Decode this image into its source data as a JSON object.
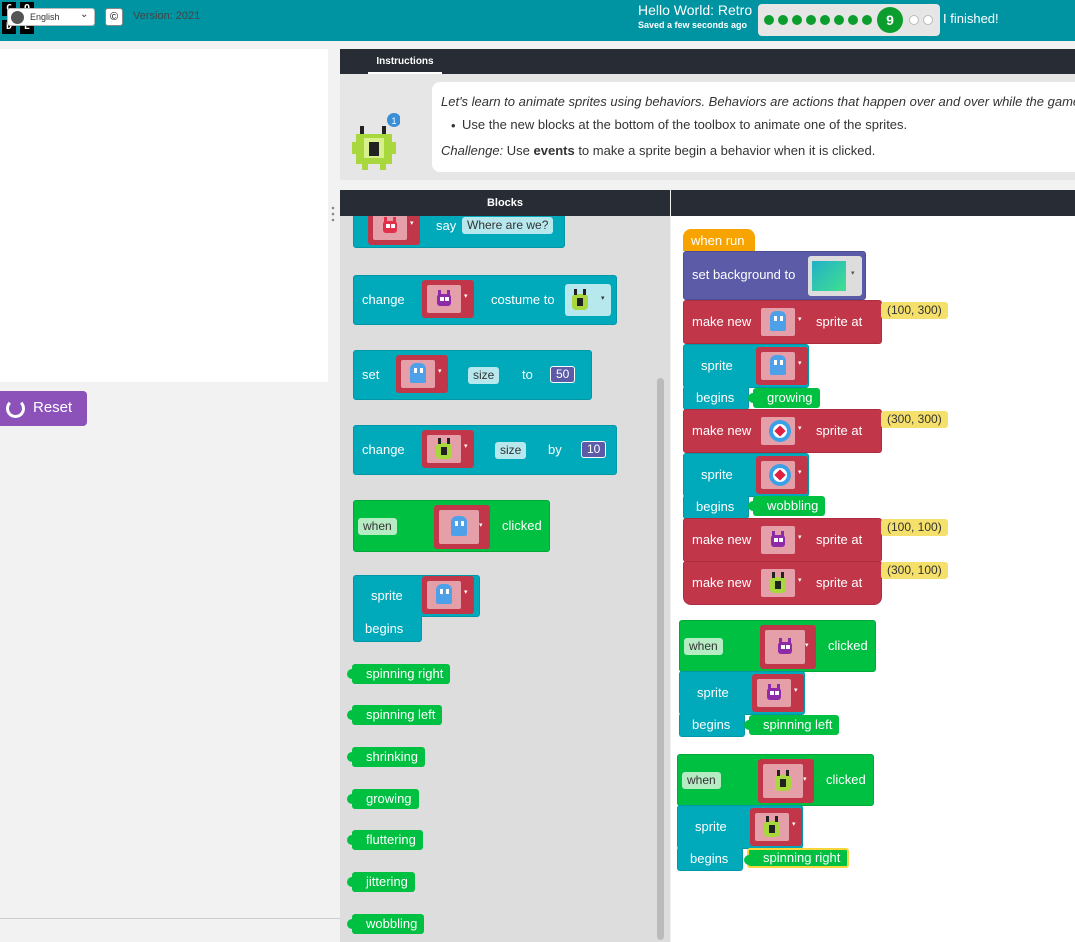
{
  "header": {
    "logo_letters": [
      "C",
      "O",
      "D",
      "E"
    ],
    "project_title": "Hello World: Retro",
    "saved_status": "Saved a few seconds ago",
    "progress": {
      "completed_levels": 8,
      "current_level": "9",
      "remaining_levels": 2
    },
    "finish_label": "I finished!",
    "colors": {
      "header_bg": "#0094a3",
      "done": "#0b9e2e"
    }
  },
  "stage": {
    "reset_label": "Reset",
    "reset_icon": "refresh-icon"
  },
  "footer": {
    "language": "English",
    "copyright_symbol": "©",
    "version": "Version: 2021"
  },
  "instructions": {
    "tab_label": "Instructions",
    "line1": "Let's learn to animate sprites using behaviors. Behaviors are actions that happen over and over while the game is running.",
    "bullet": "Use the new blocks at the bottom of the toolbox to animate one of the sprites.",
    "challenge_prefix": "Challenge:",
    "challenge_mid1": " Use ",
    "challenge_bold": "events",
    "challenge_rest": " to make a sprite begin a behavior when it is clicked.",
    "mascot_badge": "1"
  },
  "toolbox": {
    "header": "Blocks",
    "say_block": {
      "label": "say",
      "value": "Where are we?"
    },
    "change_costume": {
      "label": "change",
      "label2": "costume to"
    },
    "set_size": {
      "label": "set",
      "prop": "size",
      "to": "to",
      "value": "50"
    },
    "change_size": {
      "label": "change",
      "prop": "size",
      "by": "by",
      "value": "10"
    },
    "when_clicked": {
      "when": "when",
      "clicked": "clicked"
    },
    "sprite_begins": {
      "sprite": "sprite",
      "begins": "begins"
    },
    "behaviors": [
      "spinning right",
      "spinning left",
      "shrinking",
      "growing",
      "fluttering",
      "jittering",
      "wobbling"
    ]
  },
  "workspace": {
    "when_run": "when run",
    "set_background": "set background to",
    "make_new": "make new",
    "sprite_at": "sprite at",
    "sprite": "sprite",
    "begins": "begins",
    "when": "when",
    "clicked": "clicked",
    "coords": [
      "(100, 300)",
      "(300, 300)",
      "(100, 100)",
      "(300, 100)"
    ],
    "behaviors_used": [
      "growing",
      "wobbling",
      "spinning left",
      "spinning right"
    ]
  }
}
